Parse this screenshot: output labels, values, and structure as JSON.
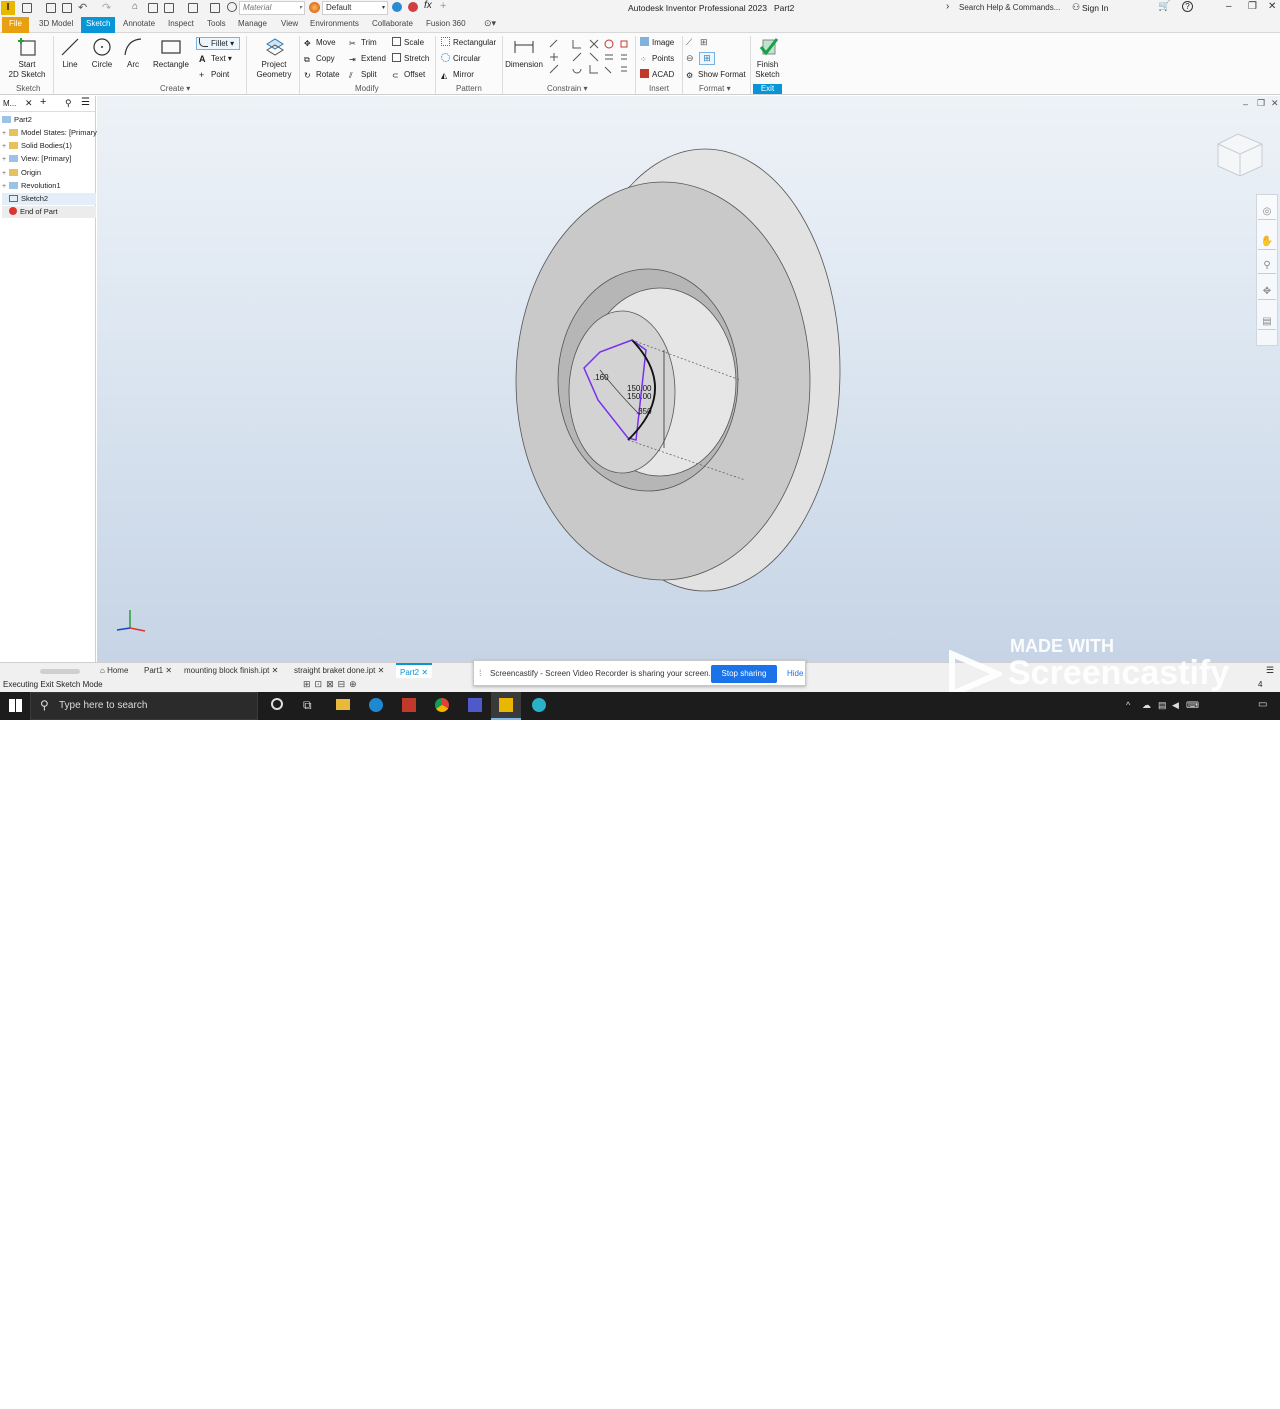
{
  "app": {
    "title": "Autodesk Inventor Professional 2023",
    "doc_name": "Part2",
    "logo_letter": "I"
  },
  "quick_access": {
    "material": "Material",
    "appearance": "Default",
    "search_placeholder": "Search Help & Commands...",
    "sign_in": "Sign In"
  },
  "tabs": [
    "File",
    "3D Model",
    "Sketch",
    "Annotate",
    "Inspect",
    "Tools",
    "Manage",
    "View",
    "Environments",
    "Collaborate",
    "Fusion 360"
  ],
  "active_tab": "Sketch",
  "ribbon": {
    "sketch_panel": {
      "start_2d_sketch": "Start\n2D Sketch",
      "label": "Sketch"
    },
    "create_panel": {
      "line": "Line",
      "circle": "Circle",
      "arc": "Arc",
      "rectangle": "Rectangle",
      "fillet": "Fillet",
      "text": "Text",
      "point": "Point",
      "label": "Create"
    },
    "project_geometry": "Project\nGeometry",
    "modify_panel": {
      "move": "Move",
      "copy": "Copy",
      "rotate": "Rotate",
      "trim": "Trim",
      "extend": "Extend",
      "split": "Split",
      "scale": "Scale",
      "stretch": "Stretch",
      "offset": "Offset",
      "label": "Modify"
    },
    "pattern_panel": {
      "rectangular": "Rectangular",
      "circular": "Circular",
      "mirror": "Mirror",
      "label": "Pattern"
    },
    "constrain_panel": {
      "dimension": "Dimension",
      "label": "Constrain"
    },
    "insert_panel": {
      "image": "Image",
      "points": "Points",
      "acad": "ACAD",
      "label": "Insert"
    },
    "format_panel": {
      "show_format": "Show Format",
      "label": "Format"
    },
    "exit_panel": {
      "finish_sketch": "Finish\nSketch",
      "label": "Exit"
    }
  },
  "browser": {
    "header": "M...",
    "items": [
      {
        "label": "Part2"
      },
      {
        "label": "Model States: [Primary]"
      },
      {
        "label": "Solid Bodies(1)"
      },
      {
        "label": "View: [Primary]"
      },
      {
        "label": "Origin"
      },
      {
        "label": "Revolution1"
      },
      {
        "label": "Sketch2"
      },
      {
        "label": "End of Part"
      }
    ]
  },
  "sketch_dims": {
    "d1": ".160",
    "d2": "150.00",
    "d3": "150.00",
    "d4": ".350"
  },
  "doc_tabs": [
    "Home",
    "Part1",
    "mounting block finish.ipt",
    "straight braket done.ipt",
    "Part2"
  ],
  "status": {
    "text": "Executing Exit Sketch Mode",
    "page_num": "4"
  },
  "share_bar": {
    "text": "Screencastify - Screen Video Recorder is sharing your screen.",
    "stop": "Stop sharing",
    "hide": "Hide"
  },
  "watermark": {
    "made_with": "MADE WITH",
    "brand": "Screencastify"
  },
  "taskbar": {
    "search": "Type here to search",
    "time": "9:53 AM",
    "date": "1/25/2023"
  },
  "colors": {
    "accent": "#0696d7",
    "file_tab": "#e8a010",
    "sketch_profile": "#7a2ff0"
  }
}
